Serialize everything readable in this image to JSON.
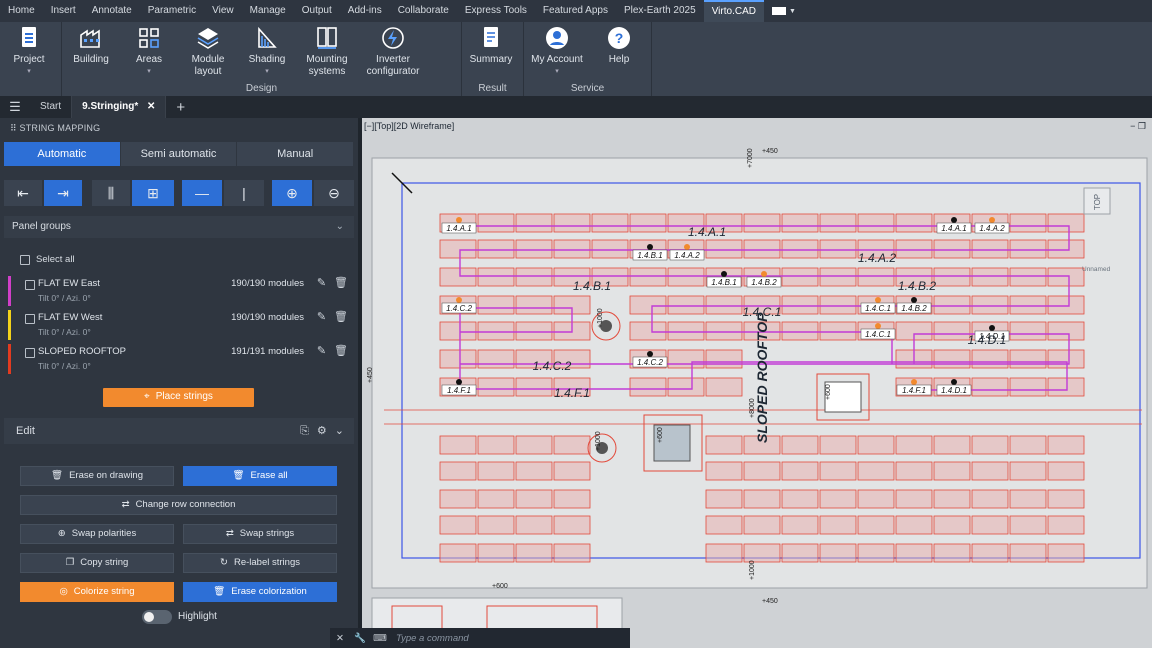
{
  "menubar": {
    "items": [
      "Home",
      "Insert",
      "Annotate",
      "Parametric",
      "View",
      "Manage",
      "Output",
      "Add-ins",
      "Collaborate",
      "Express Tools",
      "Featured Apps",
      "Plex-Earth 2025",
      "Virto.CAD"
    ]
  },
  "ribbon": {
    "project": "Project",
    "building": "Building",
    "areas": "Areas",
    "module_layout_1": "Module",
    "module_layout_2": "layout",
    "shading": "Shading",
    "mounting_1": "Mounting",
    "mounting_2": "systems",
    "inverter_1": "Inverter",
    "inverter_2": "configurator",
    "summary": "Summary",
    "my_account": "My Account",
    "help": "Help",
    "group_design": "Design",
    "group_result": "Result",
    "group_service": "Service"
  },
  "tabs": {
    "start": "Start",
    "active": "9.Stringing*"
  },
  "panel": {
    "title": "STRING MAPPING",
    "modes": [
      "Automatic",
      "Semi automatic",
      "Manual"
    ],
    "panel_groups": "Panel groups",
    "select_all": "Select all",
    "groups": [
      {
        "name": "FLAT EW East",
        "tilt": "Tilt 0° / Azi. 0°",
        "modules": "190/190 modules",
        "color": "#d03fc8"
      },
      {
        "name": "FLAT EW West",
        "tilt": "Tilt 0° / Azi. 0°",
        "modules": "190/190 modules",
        "color": "#f2d21b"
      },
      {
        "name": "SLOPED ROOFTOP",
        "tilt": "Tilt 0° / Azi. 0°",
        "modules": "191/191 modules",
        "color": "#e23b20"
      }
    ],
    "place_strings": "Place strings",
    "edit": "Edit",
    "buttons": {
      "erase_on_drawing": "Erase on drawing",
      "erase_all": "Erase all",
      "change_row": "Change row connection",
      "swap_polarities": "Swap polarities",
      "swap_strings": "Swap strings",
      "copy_string": "Copy string",
      "relabel": "Re-label strings",
      "colorize": "Colorize string",
      "erase_colorization": "Erase colorization"
    },
    "highlight": "Highlight"
  },
  "viewport": {
    "label": "[−][Top][2D Wireframe]",
    "viewcube": "TOP",
    "unnamed": "Unnamed"
  },
  "drawing": {
    "roof_label": "SLOPED ROOFTOP",
    "string_labels": [
      "1.4.A.1",
      "1.4.A.2",
      "1.4.B.1",
      "1.4.B.2",
      "1.4.C.1",
      "1.4.C.2",
      "1.4.D.1",
      "1.4.F.1"
    ],
    "pin_labels": [
      "1.4.A.1",
      "1.4.B.1",
      "1.4.A.2",
      "1.4.B.1",
      "1.4.B.2",
      "1.4.A.1",
      "1.4.A.2",
      "1.4.C.2",
      "1.4.C.1",
      "1.4.B.2",
      "1.4.C.1",
      "1.4.D.1",
      "1.4.C.2",
      "1.4.F.1",
      "1.4.F.1",
      "1.4.D.1"
    ],
    "elevations": [
      "+450",
      "+7000",
      "+1000",
      "+600",
      "+8000",
      "+1000",
      "+600",
      "+600",
      "+1000",
      "+450",
      "+450"
    ]
  },
  "cmdline": {
    "placeholder": "Type a command"
  },
  "colors": {
    "accent": "#2d6fd6",
    "orange": "#f28a2e",
    "string": "#c23bd6",
    "panel_outline": "#e24a3b"
  }
}
